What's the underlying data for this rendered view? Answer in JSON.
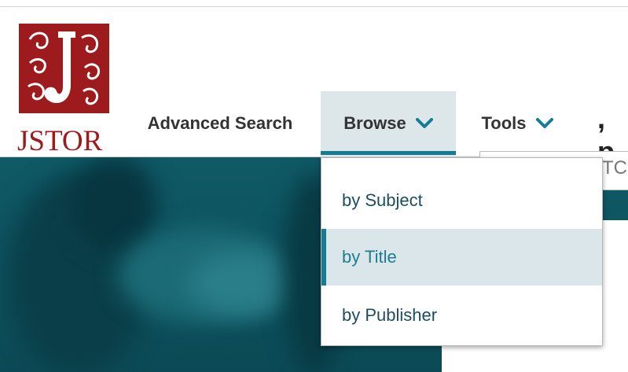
{
  "brand": {
    "name": "JSTOR",
    "color": "#9e1b1d"
  },
  "nav": {
    "advanced_search": "Advanced Search",
    "browse": "Browse",
    "tools": "Tools",
    "active": "Browse",
    "accent_color": "#137d94"
  },
  "browse_menu": {
    "items": [
      {
        "label": "by Subject"
      },
      {
        "label": "by Title",
        "state": "hovered"
      },
      {
        "label": "by Publisher"
      }
    ]
  },
  "hero": {
    "heading_partial": ", p",
    "search_partial": "TC"
  }
}
